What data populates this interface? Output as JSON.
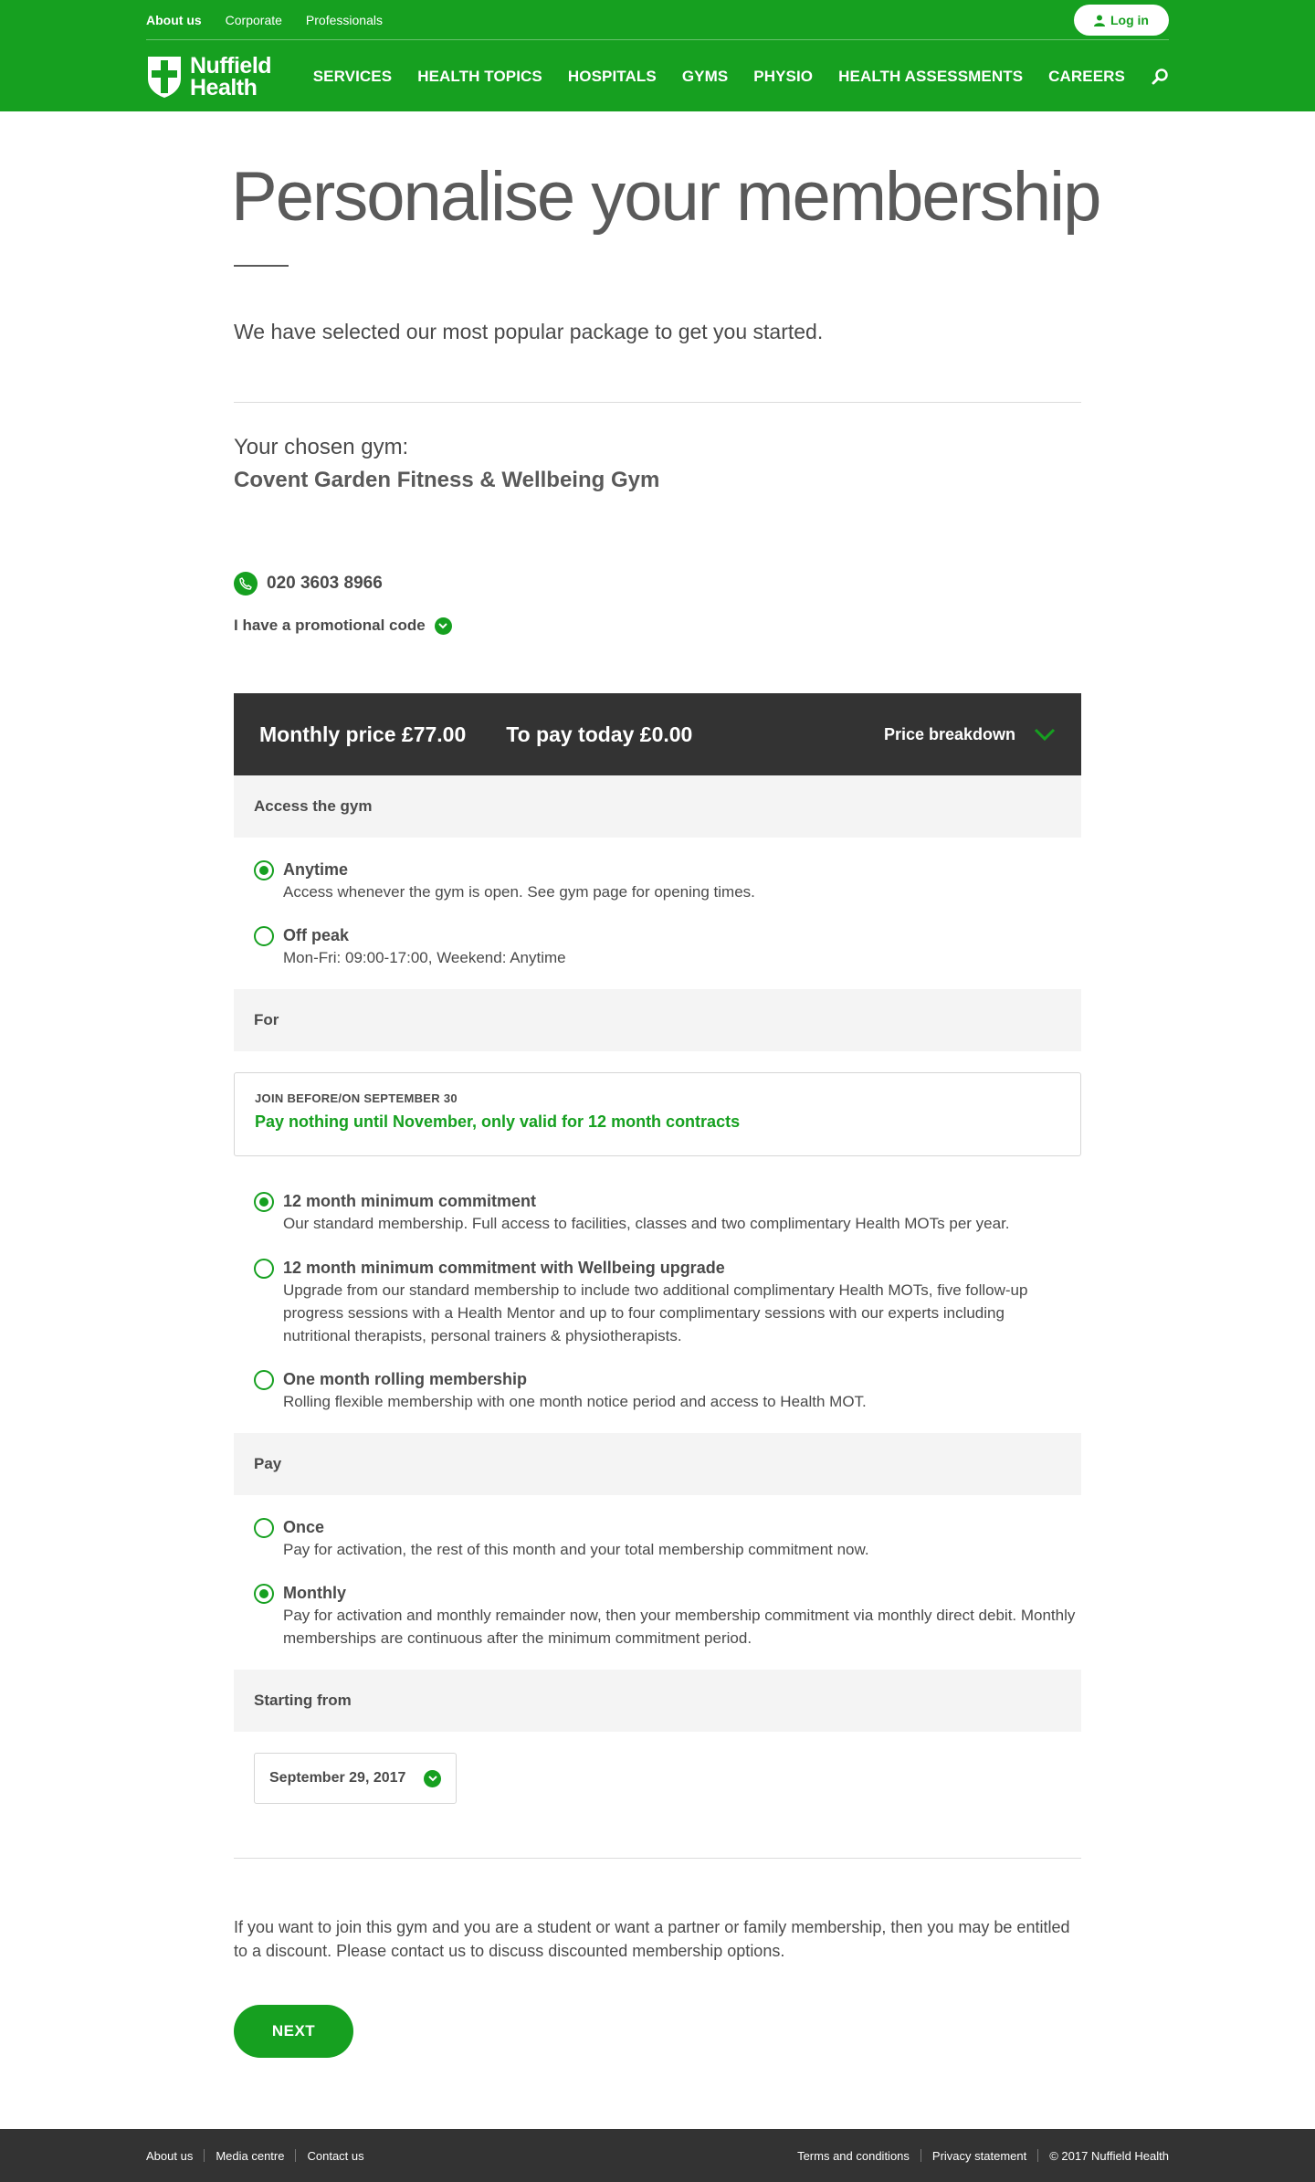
{
  "header": {
    "utility_links": [
      "About us",
      "Corporate",
      "Professionals"
    ],
    "login_label": "Log in",
    "brand_line1": "Nuffield",
    "brand_line2": "Health",
    "nav": [
      "SERVICES",
      "HEALTH TOPICS",
      "HOSPITALS",
      "GYMS",
      "PHYSIO",
      "HEALTH ASSESSMENTS",
      "CAREERS"
    ],
    "icons": {
      "search": "search-icon",
      "user": "user-icon",
      "logo": "cross-shield-logo"
    }
  },
  "colors": {
    "brand_green": "#16a020",
    "dark_bar": "#333333",
    "section_bg": "#f4f4f4",
    "text": "#4a4a4a"
  },
  "page": {
    "title": "Personalise your membership",
    "intro": "We have selected our most popular package to get you started.",
    "gym_label": "Your chosen gym:",
    "gym_name": "Covent Garden Fitness & Wellbeing Gym",
    "phone": "020 3603 8966",
    "promo_label": "I have a promotional code"
  },
  "pricebar": {
    "monthly": "Monthly price £77.00",
    "today": "To pay today £0.00",
    "breakdown": "Price breakdown"
  },
  "access": {
    "heading": "Access the gym",
    "options": [
      {
        "label": "Anytime",
        "desc": "Access whenever the gym is open. See gym page for opening times.",
        "selected": true
      },
      {
        "label": "Off peak",
        "desc": "Mon-Fri: 09:00-17:00, Weekend: Anytime",
        "selected": false
      }
    ]
  },
  "for": {
    "heading": "For",
    "offer_kicker": "JOIN BEFORE/ON SEPTEMBER 30",
    "offer_text": "Pay nothing until November, only valid for 12 month contracts",
    "options": [
      {
        "label": "12 month minimum commitment",
        "desc": "Our standard membership. Full access to facilities, classes and two complimentary Health MOTs per year.",
        "selected": true
      },
      {
        "label": "12 month minimum commitment with Wellbeing upgrade",
        "desc": "Upgrade from our standard membership to include two additional complimentary Health MOTs, five follow-up progress sessions with a Health Mentor and up to four complimentary sessions with our experts including nutritional therapists, personal trainers & physiotherapists.",
        "selected": false
      },
      {
        "label": "One month rolling membership",
        "desc": "Rolling flexible membership with one month notice period and access to Health MOT.",
        "selected": false
      }
    ]
  },
  "pay": {
    "heading": "Pay",
    "options": [
      {
        "label": "Once",
        "desc": "Pay for activation, the rest of this month and your total membership commitment now.",
        "selected": false
      },
      {
        "label": "Monthly",
        "desc": "Pay for activation and monthly remainder now, then your membership commitment via monthly direct debit. Monthly memberships are continuous after the minimum commitment period.",
        "selected": true
      }
    ]
  },
  "start": {
    "heading": "Starting from",
    "date": "September 29, 2017"
  },
  "discount_text": "If you want to join this gym and you are a student or want a partner or family membership, then you may be entitled to a discount. Please contact us to discuss discounted membership options.",
  "next_label": "NEXT",
  "footer": {
    "left": [
      "About us",
      "Media centre",
      "Contact us"
    ],
    "right": [
      "Terms and conditions",
      "Privacy statement",
      "© 2017 Nuffield Health"
    ]
  }
}
